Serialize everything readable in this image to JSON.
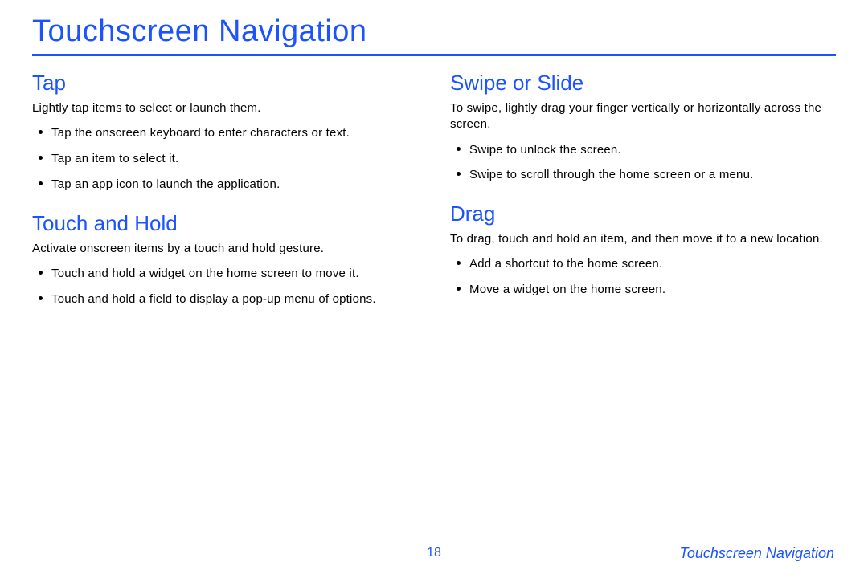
{
  "title": "Touchscreen Navigation",
  "left": {
    "sections": [
      {
        "heading": "Tap",
        "intro": "Lightly tap items to select or launch them.",
        "bullets": [
          "Tap the onscreen keyboard to enter characters or text.",
          "Tap an item to select it.",
          "Tap an app icon to launch the application."
        ]
      },
      {
        "heading": "Touch and Hold",
        "intro": "Activate onscreen items by a touch and hold gesture.",
        "bullets": [
          "Touch and hold a widget on the home screen to move it.",
          "Touch and hold a field to display a pop-up menu of options."
        ]
      }
    ]
  },
  "right": {
    "sections": [
      {
        "heading": "Swipe or Slide",
        "intro": "To swipe, lightly drag your finger vertically or horizontally across the screen.",
        "bullets": [
          "Swipe to unlock the screen.",
          "Swipe to scroll through the home screen or a menu."
        ]
      },
      {
        "heading": "Drag",
        "intro": "To drag, touch and hold an item, and then move it to a new location.",
        "bullets": [
          "Add a shortcut to the home screen.",
          "Move a widget on the home screen."
        ]
      }
    ]
  },
  "footer": {
    "page_number": "18",
    "label": "Touchscreen Navigation"
  }
}
